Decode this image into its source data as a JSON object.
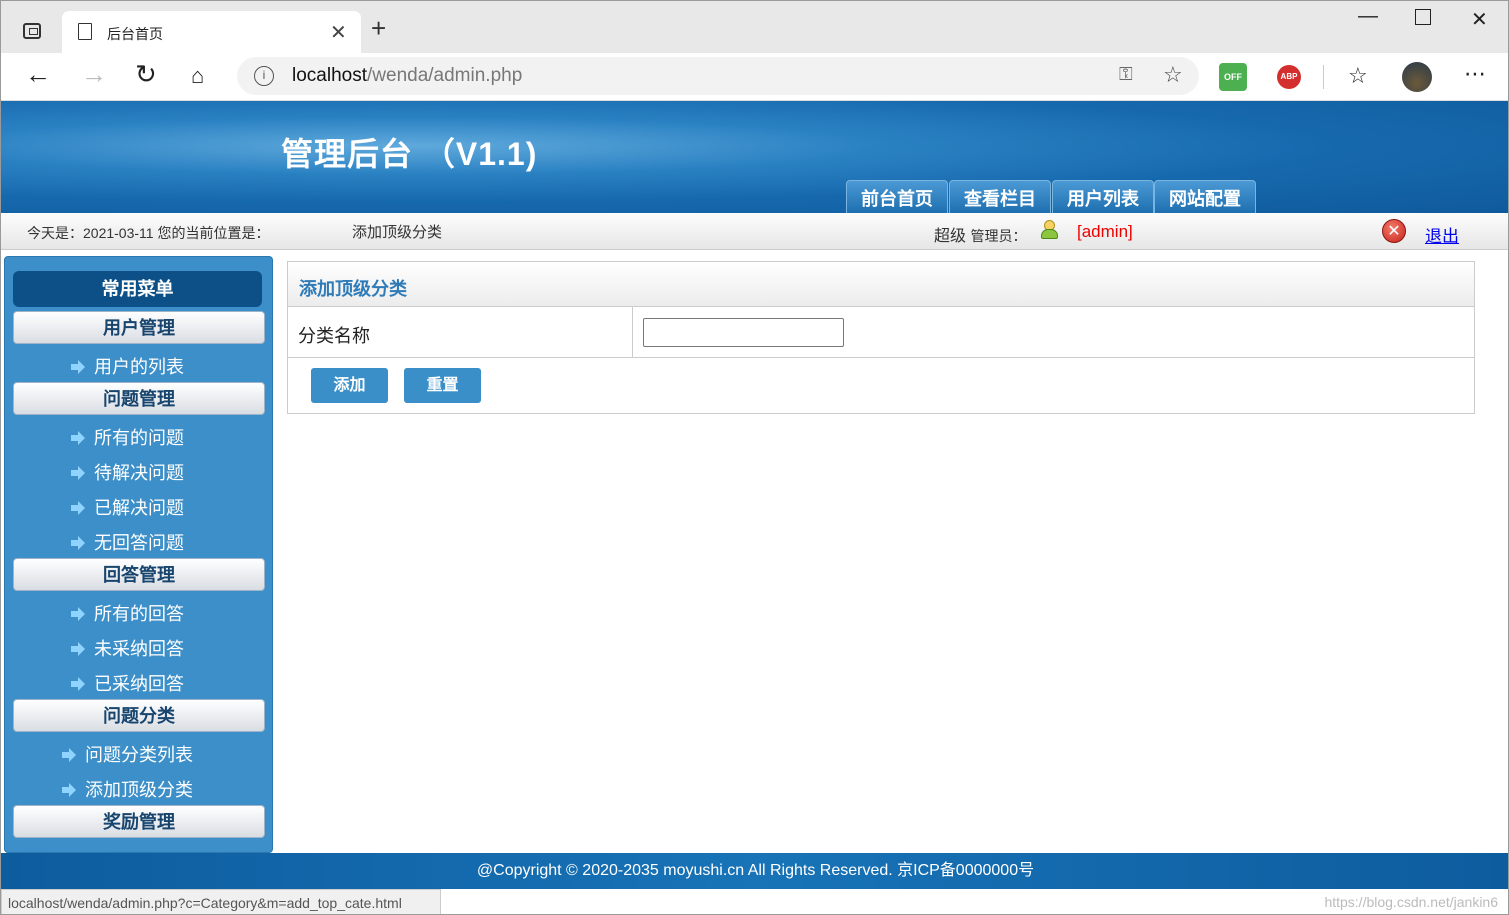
{
  "browser": {
    "tab_title": "后台首页",
    "new_tab_glyph": "+",
    "url_host": "localhost",
    "url_path": "/wenda/admin.php",
    "ext_off_label": "OFF",
    "ext_abp_label": "ABP",
    "status_url": "localhost/wenda/admin.php?c=Category&m=add_top_cate.html",
    "watermark": "https://blog.csdn.net/jankin6"
  },
  "header": {
    "title": "管理后台 （V1.1)",
    "nav": [
      "前台首页",
      "查看栏目",
      "用户列表",
      "网站配置"
    ]
  },
  "infobar": {
    "date_text": "今天是：2021-03-11 您的当前位置是：",
    "location": "添加顶级分类",
    "role": "超级",
    "role_suffix": "管理员：",
    "username": "[admin]",
    "logout": "退出"
  },
  "sidebar": {
    "title": "常用菜单",
    "sections": [
      {
        "label": "用户管理",
        "items": [
          "用户的列表"
        ]
      },
      {
        "label": "问题管理",
        "items": [
          "所有的问题",
          "待解决问题",
          "已解决问题",
          "无回答问题"
        ]
      },
      {
        "label": "回答管理",
        "items": [
          "所有的回答",
          "未采纳回答",
          "已采纳回答"
        ]
      },
      {
        "label": "问题分类",
        "items": [
          "问题分类列表",
          "添加顶级分类"
        ]
      },
      {
        "label": "奖励管理",
        "items": []
      }
    ]
  },
  "form": {
    "heading": "添加顶级分类",
    "field_label": "分类名称",
    "field_value": "",
    "submit": "添加",
    "reset": "重置"
  },
  "footer": {
    "text": "@Copyright © 2020-2035 moyushi.cn All Rights Reserved. 京ICP备0000000号"
  },
  "colors": {
    "brand_blue": "#1668ad",
    "sidebar_blue": "#3c8fc8",
    "button_blue": "#3a8fc8",
    "admin_red": "#ee0000"
  }
}
